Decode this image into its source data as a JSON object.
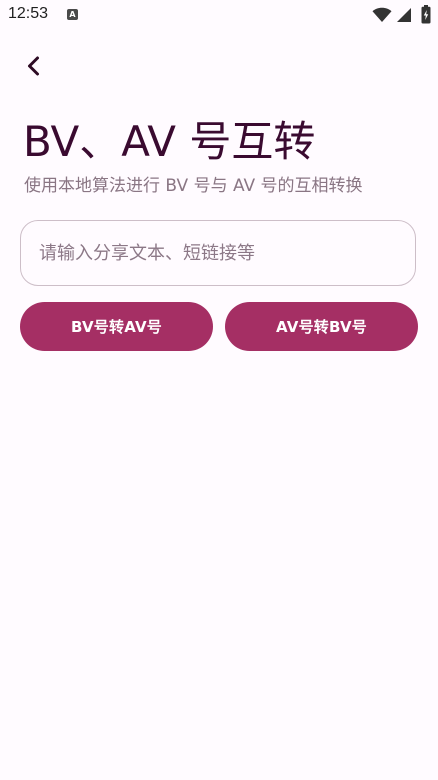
{
  "status_bar": {
    "time": "12:53",
    "notification_icon_letter": "A",
    "icons": [
      "wifi-icon",
      "signal-icon",
      "battery-icon"
    ]
  },
  "header": {
    "back_icon": "chevron-left-icon",
    "title": "BV、AV 号互转",
    "subtitle": "使用本地算法进行 BV 号与 AV 号的互相转换"
  },
  "input": {
    "value": "",
    "placeholder": "请输入分享文本、短链接等"
  },
  "actions": {
    "bv_to_av_label": "BV号转AV号",
    "av_to_bv_label": "AV号转BV号"
  },
  "colors": {
    "background": "#fffbff",
    "title": "#3a0a30",
    "subtitle": "#8a7684",
    "input_border": "#cdbec8",
    "button": "#a52f64",
    "button_text": "#ffffff"
  }
}
